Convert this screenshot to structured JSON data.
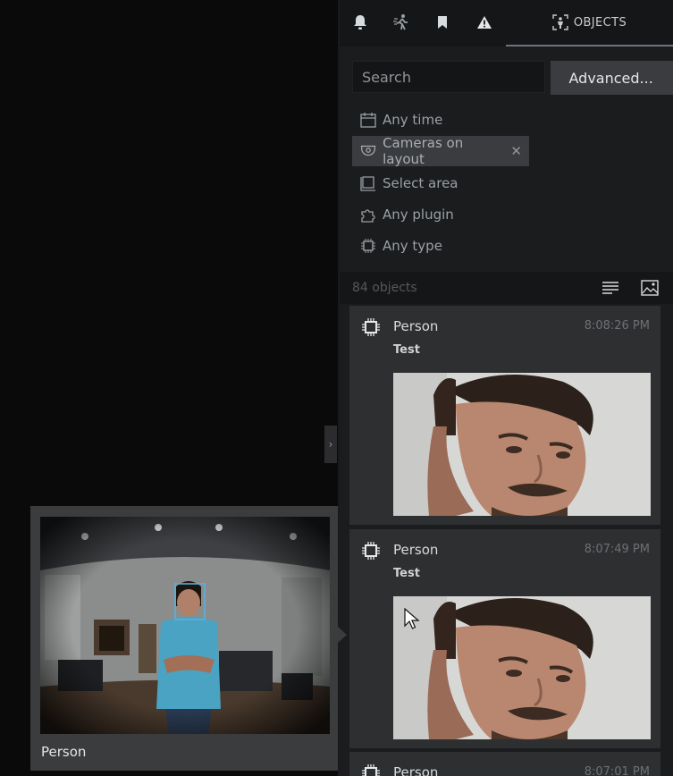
{
  "tabs": {
    "notifications_icon": "bell-icon",
    "motion_icon": "motion-icon",
    "bookmarks_icon": "bookmark-icon",
    "events_icon": "warning-icon",
    "objects_label": "OBJECTS"
  },
  "search": {
    "placeholder": "Search",
    "advanced_label": "Advanced..."
  },
  "filters": {
    "time": "Any time",
    "cameras": "Cameras on layout",
    "area": "Select area",
    "plugin": "Any plugin",
    "type": "Any type"
  },
  "results": {
    "count": "84 objects"
  },
  "cards": [
    {
      "title": "Person",
      "subtitle": "Test",
      "time": "8:08:26 PM"
    },
    {
      "title": "Person",
      "subtitle": "Test",
      "time": "8:07:49 PM"
    },
    {
      "title": "Person",
      "subtitle": "",
      "time": "8:07:01 PM"
    }
  ],
  "tooltip": {
    "label": "Person"
  },
  "colors": {
    "panel_bg": "#1b1c1e",
    "card_bg": "#2e2f31",
    "chip_bg": "#3a3c3f",
    "face_box": "#5aaee0"
  }
}
